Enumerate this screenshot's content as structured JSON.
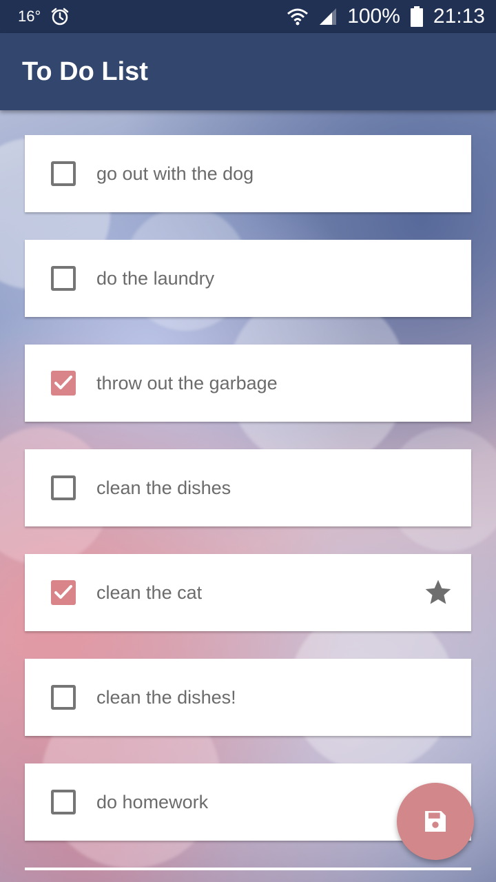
{
  "status_bar": {
    "temperature": "16°",
    "battery": "100%",
    "time": "21:13",
    "icons": [
      "alarm-icon",
      "wifi-icon",
      "signal-icon",
      "battery-icon"
    ]
  },
  "app_bar": {
    "title": "To Do List"
  },
  "todos": [
    {
      "text": "go out with the dog",
      "checked": false,
      "starred": false
    },
    {
      "text": "do the laundry",
      "checked": false,
      "starred": false
    },
    {
      "text": "throw out the garbage",
      "checked": true,
      "starred": false
    },
    {
      "text": "clean the dishes",
      "checked": false,
      "starred": false
    },
    {
      "text": "clean the cat",
      "checked": true,
      "starred": true
    },
    {
      "text": "clean the dishes!",
      "checked": false,
      "starred": false
    },
    {
      "text": "do homework",
      "checked": false,
      "starred": false
    }
  ],
  "fab": {
    "icon": "save-icon"
  },
  "colors": {
    "status_bar": "#213154",
    "app_bar": "#33476e",
    "accent": "#d98488",
    "text": "#6b6b6b"
  }
}
